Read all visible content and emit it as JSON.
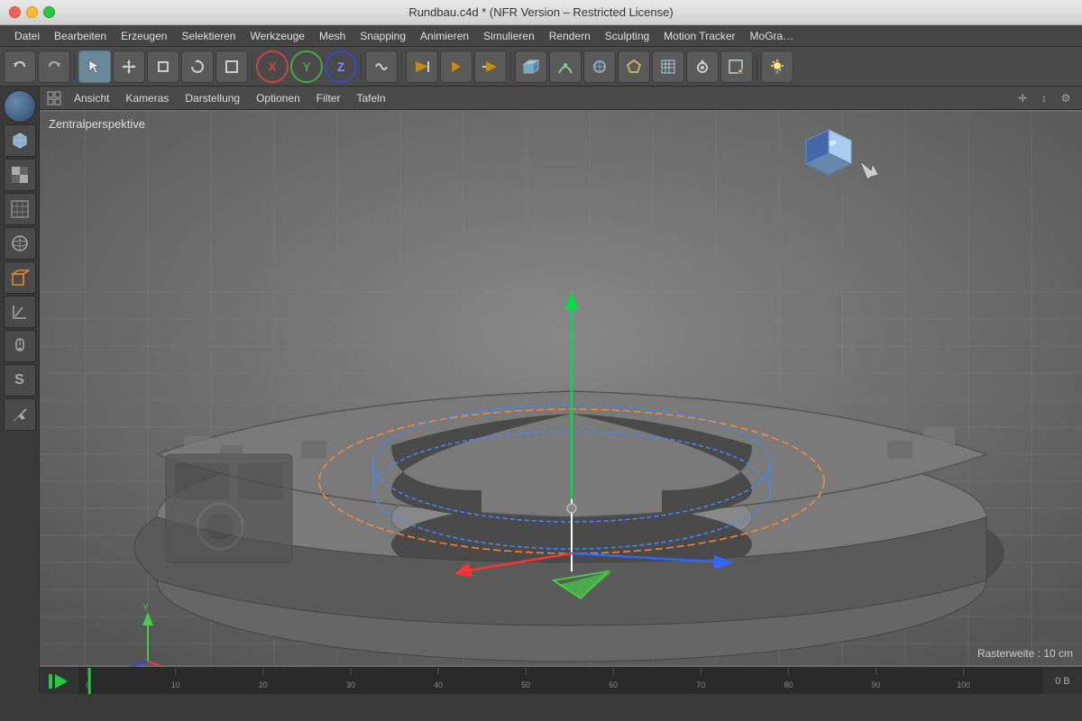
{
  "titlebar": {
    "title": "Rundbau.c4d * (NFR Version – Restricted License)"
  },
  "menubar": {
    "items": [
      "Datei",
      "Bearbeiten",
      "Erzeugen",
      "Selektieren",
      "Werkzeuge",
      "Mesh",
      "Snapping",
      "Animieren",
      "Simulieren",
      "Rendern",
      "Sculpting",
      "Motion Tracker",
      "MoGra…"
    ]
  },
  "toolbar": {
    "undo_label": "↩",
    "redo_label": "↪",
    "select_label": "▷",
    "move_label": "✛",
    "scale_label": "⊞",
    "rotate_label": "↻",
    "object_label": "□",
    "axis_x": "X",
    "axis_y": "Y",
    "axis_z": "Z",
    "wrap_label": "⌒"
  },
  "viewport_toolbar": {
    "items": [
      "Ansicht",
      "Kameras",
      "Darstellung",
      "Optionen",
      "Filter",
      "Tafeln"
    ]
  },
  "viewport": {
    "label": "Zentralperspektive",
    "raster_info": "Rasterweite : 10 cm"
  },
  "timeline": {
    "frame_current": "0",
    "frame_counter": "0 B",
    "markers": [
      "0",
      "10",
      "20",
      "30",
      "40",
      "50",
      "60",
      "70",
      "80",
      "90",
      "100"
    ]
  },
  "sidebar": {
    "tools": [
      "globe",
      "cube",
      "checker",
      "grid",
      "sphere",
      "box",
      "triangle",
      "mouse",
      "S",
      "wrench"
    ]
  }
}
